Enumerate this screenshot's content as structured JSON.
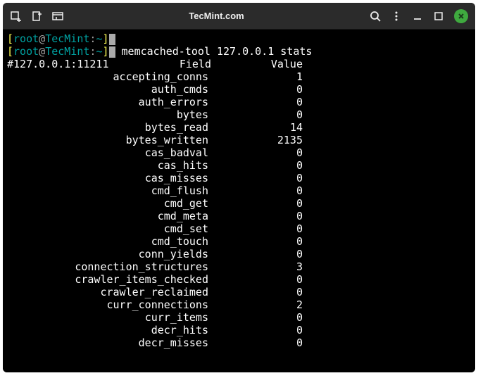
{
  "titlebar": {
    "title": "TecMint.com"
  },
  "prompt1": {
    "open": "[",
    "user": "root",
    "at": "@",
    "host": "TecMint",
    "colon": ":",
    "path": "~",
    "close": "]"
  },
  "prompt2": {
    "open": "[",
    "user": "root",
    "at": "@",
    "host": "TecMint",
    "colon": ":",
    "path": "~",
    "close": "]",
    "cmd": " memcached-tool 127.0.0.1 stats"
  },
  "header": {
    "addr": "#127.0.0.1:11211",
    "field": "Field",
    "value": "Value"
  },
  "stats": [
    {
      "field": "accepting_conns",
      "value": "1"
    },
    {
      "field": "auth_cmds",
      "value": "0"
    },
    {
      "field": "auth_errors",
      "value": "0"
    },
    {
      "field": "bytes",
      "value": "0"
    },
    {
      "field": "bytes_read",
      "value": "14"
    },
    {
      "field": "bytes_written",
      "value": "2135"
    },
    {
      "field": "cas_badval",
      "value": "0"
    },
    {
      "field": "cas_hits",
      "value": "0"
    },
    {
      "field": "cas_misses",
      "value": "0"
    },
    {
      "field": "cmd_flush",
      "value": "0"
    },
    {
      "field": "cmd_get",
      "value": "0"
    },
    {
      "field": "cmd_meta",
      "value": "0"
    },
    {
      "field": "cmd_set",
      "value": "0"
    },
    {
      "field": "cmd_touch",
      "value": "0"
    },
    {
      "field": "conn_yields",
      "value": "0"
    },
    {
      "field": "connection_structures",
      "value": "3"
    },
    {
      "field": "crawler_items_checked",
      "value": "0"
    },
    {
      "field": "crawler_reclaimed",
      "value": "0"
    },
    {
      "field": "curr_connections",
      "value": "2"
    },
    {
      "field": "curr_items",
      "value": "0"
    },
    {
      "field": "decr_hits",
      "value": "0"
    },
    {
      "field": "decr_misses",
      "value": "0"
    }
  ]
}
